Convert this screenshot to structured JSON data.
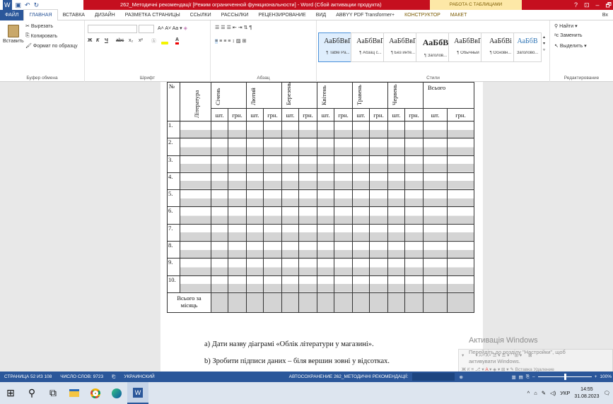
{
  "titlebar": {
    "doc_title": "262_Методичні рекомендації [Режим ограниченной функциональности] - Word (Сбой активации продукта)",
    "context_tab": "РАБОТА С ТАБЛИЦАМИ",
    "controls": [
      "?",
      "⊡",
      "–",
      "🗗",
      "✕"
    ]
  },
  "tabs": [
    "ФАЙЛ",
    "ГЛАВНАЯ",
    "ВСТАВКА",
    "ДИЗАЙН",
    "РАЗМЕТКА СТРАНИЦЫ",
    "ССЫЛКИ",
    "РАССЫЛКИ",
    "РЕЦЕНЗИРОВАНИЕ",
    "ВИД",
    "ABBYY PDF Transformer+",
    "КОНСТРУКТОР",
    "МАКЕТ"
  ],
  "account_label": "Вх",
  "ribbon": {
    "clipboard": {
      "paste": "Вставить",
      "cut": "Вырезать",
      "copy": "Копировать",
      "format": "Формат по образцу",
      "label": "Буфер обмена"
    },
    "font": {
      "label": "Шрифт",
      "bold": "Ж",
      "italic": "К",
      "underline": "Ч",
      "strike": "abc",
      "sub": "x₂",
      "sup": "x²"
    },
    "paragraph": {
      "label": "Абзац"
    },
    "styles": {
      "label": "Стили",
      "items": [
        {
          "sample": "АаБбВвГ",
          "name": "¶ Table Pa..."
        },
        {
          "sample": "АаБбВвГ",
          "name": "¶ Абзац с..."
        },
        {
          "sample": "АаБбВвГ",
          "name": "¶ Без инте..."
        },
        {
          "sample": "АаБбВ",
          "name": "¶ Заголов..."
        },
        {
          "sample": "АаБбВвГ",
          "name": "¶ Обычный"
        },
        {
          "sample": "АаБбВі",
          "name": "¶ Основн..."
        },
        {
          "sample": "АаБбВ",
          "name": "Заголово..."
        }
      ]
    },
    "editing": {
      "find": "Найти",
      "replace": "Заменить",
      "select": "Выделить",
      "label": "Редактирование"
    }
  },
  "table": {
    "no_header": "№",
    "lit_header": "Література",
    "months": [
      "Січень",
      "Лютий",
      "Березень",
      "Квітень",
      "Травень",
      "Червень"
    ],
    "total_header": "Всього",
    "unit_pcs": "шт.",
    "unit_uah": "грн.",
    "rows": [
      "1.",
      "2.",
      "3.",
      "4.",
      "5.",
      "6.",
      "7.",
      "8.",
      "9.",
      "10."
    ],
    "total_row": "Всього за місяць"
  },
  "doc_text": {
    "line1": "а) Дати назву діаграмі «Облік літератури у магазині».",
    "line2": "b) Зробити підписи даних – біля вершин зовні у відсотках."
  },
  "minitoolbar": {
    "insert": "Вставка",
    "delete": "Удаление"
  },
  "watermark": {
    "title": "Активація Windows",
    "line1": "Перейдіть до розділу \"Настройки\", щоб",
    "line2": "активувати Windows."
  },
  "statusbar": {
    "page": "СТРАНИЦА 52 ИЗ 108",
    "words": "ЧИСЛО СЛОВ: 9723",
    "lang": "УКРАИНСКИЙ",
    "autosave": "АВТОСОХРАНЕНИЕ 262_МЕТОДИЧНІ РЕКОМЕНДАЦІЇ:",
    "zoom_label": "100%",
    "zoom_level": 1.0
  },
  "taskbar": {
    "lang": "УКР",
    "time": "14:55",
    "date": "31.08.2023"
  },
  "colors": {
    "accent": "#2b579a",
    "titlebar": "#c50f1f",
    "table_shade": "#d4d4d4"
  }
}
